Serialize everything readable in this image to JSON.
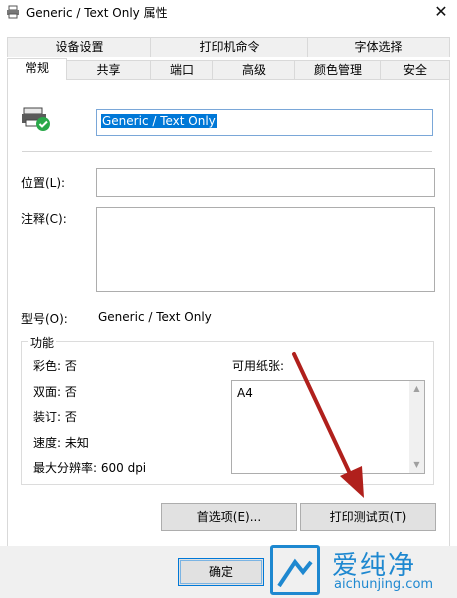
{
  "window": {
    "title": "Generic / Text Only 属性",
    "close_symbol": "✕"
  },
  "tabs_row1": [
    {
      "label": "设备设置"
    },
    {
      "label": "打印机命令"
    },
    {
      "label": "字体选择"
    }
  ],
  "tabs_row2": [
    {
      "label": "常规",
      "active": true
    },
    {
      "label": "共享"
    },
    {
      "label": "端口"
    },
    {
      "label": "高级"
    },
    {
      "label": "颜色管理"
    },
    {
      "label": "安全"
    }
  ],
  "general": {
    "printer_name": "Generic / Text Only",
    "location_label": "位置(L):",
    "location_value": "",
    "comment_label": "注释(C):",
    "comment_value": "",
    "model_label": "型号(O):",
    "model_value": "Generic / Text Only"
  },
  "features": {
    "legend": "功能",
    "color": "彩色: 否",
    "duplex": "双面: 否",
    "staple": "装订: 否",
    "speed": "速度: 未知",
    "max_resolution": "最大分辨率: 600 dpi",
    "paper_label": "可用纸张:",
    "paper_items": [
      "A4"
    ]
  },
  "buttons": {
    "preferences": "首选项(E)...",
    "print_test_page": "打印测试页(T)",
    "ok": "确定"
  },
  "watermark": {
    "cn": "爱纯净",
    "en": "aichunjing.com"
  },
  "colors": {
    "arrow": "#b0201c",
    "watermark": "#1e88d0",
    "selection": "#0078d7"
  }
}
